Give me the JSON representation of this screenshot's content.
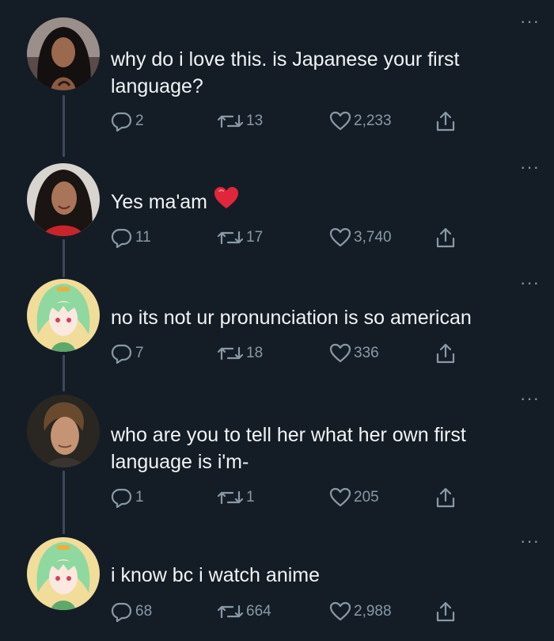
{
  "colors": {
    "background": "#141d26",
    "text": "#f2f4f5",
    "muted": "#8899a6",
    "thread_line": "#3a4a5c",
    "heart": "#e0263a"
  },
  "tweets": [
    {
      "text": "why do i love this. is Japanese your first language?",
      "emoji": "",
      "replies": "2",
      "retweets": "13",
      "likes": "2,233",
      "avatar": "woman-long-dark-hair"
    },
    {
      "text": "Yes ma'am",
      "emoji": "red-heart",
      "replies": "11",
      "retweets": "17",
      "likes": "3,740",
      "avatar": "woman-dark-hair-red-top"
    },
    {
      "text": "no its not ur pronunciation is so american",
      "emoji": "",
      "replies": "7",
      "retweets": "18",
      "likes": "336",
      "avatar": "anime-green-hair"
    },
    {
      "text": "who are you to tell her what her own first language is i'm-",
      "emoji": "",
      "replies": "1",
      "retweets": "1",
      "likes": "205",
      "avatar": "man-swept-hair"
    },
    {
      "text": "i know bc i watch anime",
      "emoji": "",
      "replies": "68",
      "retweets": "664",
      "likes": "2,988",
      "avatar": "anime-green-hair"
    }
  ]
}
